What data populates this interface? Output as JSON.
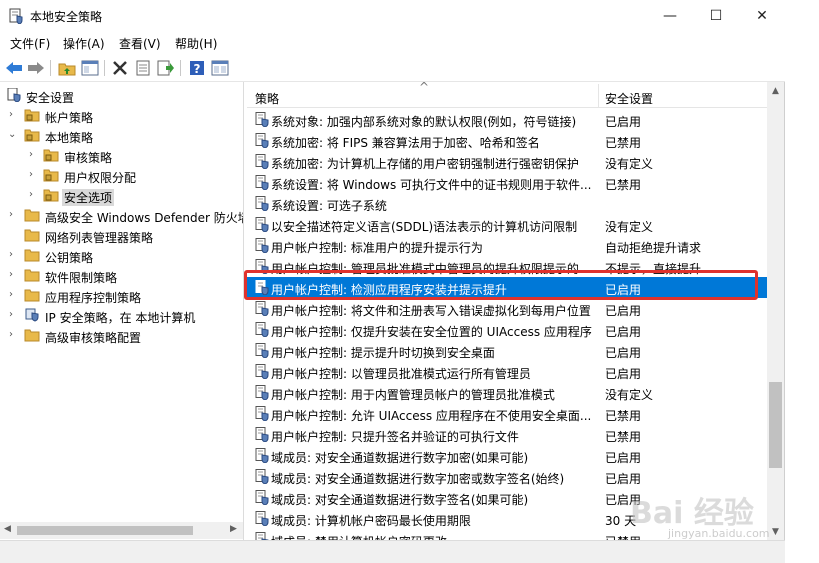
{
  "window": {
    "title": "本地安全策略",
    "minimize": "—",
    "maximize": "☐",
    "close": "✕"
  },
  "menu": [
    "文件(F)",
    "操作(A)",
    "查看(V)",
    "帮助(H)"
  ],
  "toolbar": {
    "icons": [
      "back-arrow-icon",
      "forward-arrow-icon",
      "up-folder-icon",
      "show-hide-tree-icon",
      "delete-icon",
      "properties-icon",
      "export-list-icon",
      "help-icon",
      "view-icon"
    ]
  },
  "tree": [
    {
      "label": "安全设置",
      "level": 0,
      "arrow": ""
    },
    {
      "label": "帐户策略",
      "level": 1,
      "arrow": "›"
    },
    {
      "label": "本地策略",
      "level": 1,
      "arrow": "⌄"
    },
    {
      "label": "审核策略",
      "level": 2,
      "arrow": "›"
    },
    {
      "label": "用户权限分配",
      "level": 2,
      "arrow": "›"
    },
    {
      "label": "安全选项",
      "level": 2,
      "arrow": "›",
      "selected": true
    },
    {
      "label": "高级安全 Windows Defender 防火墙",
      "level": 1,
      "arrow": "›"
    },
    {
      "label": "网络列表管理器策略",
      "level": 1,
      "arrow": ""
    },
    {
      "label": "公钥策略",
      "level": 1,
      "arrow": "›"
    },
    {
      "label": "软件限制策略",
      "level": 1,
      "arrow": "›"
    },
    {
      "label": "应用程序控制策略",
      "level": 1,
      "arrow": "›"
    },
    {
      "label": "IP 安全策略，在 本地计算机",
      "level": 1,
      "arrow": "›"
    },
    {
      "label": "高级审核策略配置",
      "level": 1,
      "arrow": "›"
    }
  ],
  "list": {
    "col_policy": "策略",
    "col_setting": "安全设置",
    "sort_indicator": "^",
    "rows": [
      {
        "name": "系统对象: 加强内部系统对象的默认权限(例如，符号链接)",
        "setting": "已启用"
      },
      {
        "name": "系统加密: 将 FIPS 兼容算法用于加密、哈希和签名",
        "setting": "已禁用"
      },
      {
        "name": "系统加密: 为计算机上存储的用户密钥强制进行强密钥保护",
        "setting": "没有定义"
      },
      {
        "name": "系统设置: 将 Windows 可执行文件中的证书规则用于软件...",
        "setting": "已禁用"
      },
      {
        "name": "系统设置: 可选子系统",
        "setting": ""
      },
      {
        "name": "以安全描述符定义语言(SDDL)语法表示的计算机访问限制",
        "setting": "没有定义"
      },
      {
        "name": "用户帐户控制: 标准用户的提升提示行为",
        "setting": "自动拒绝提升请求"
      },
      {
        "name": "用户帐户控制: 管理员批准模式中管理员的提升权限提示的...",
        "setting": "不提示，直接提升"
      },
      {
        "name": "用户帐户控制: 检测应用程序安装并提示提升",
        "setting": "已启用",
        "selected": true
      },
      {
        "name": "用户帐户控制: 将文件和注册表写入错误虚拟化到每用户位置",
        "setting": "已启用"
      },
      {
        "name": "用户帐户控制: 仅提升安装在安全位置的 UIAccess 应用程序",
        "setting": "已启用"
      },
      {
        "name": "用户帐户控制: 提示提升时切换到安全桌面",
        "setting": "已启用"
      },
      {
        "name": "用户帐户控制: 以管理员批准模式运行所有管理员",
        "setting": "已启用"
      },
      {
        "name": "用户帐户控制: 用于内置管理员帐户的管理员批准模式",
        "setting": "没有定义"
      },
      {
        "name": "用户帐户控制: 允许 UIAccess 应用程序在不使用安全桌面...",
        "setting": "已禁用"
      },
      {
        "name": "用户帐户控制: 只提升签名并验证的可执行文件",
        "setting": "已禁用"
      },
      {
        "name": "域成员: 对安全通道数据进行数字加密(如果可能)",
        "setting": "已启用"
      },
      {
        "name": "域成员: 对安全通道数据进行数字加密或数字签名(始终)",
        "setting": "已启用"
      },
      {
        "name": "域成员: 对安全通道数据进行数字签名(如果可能)",
        "setting": "已启用"
      },
      {
        "name": "域成员: 计算机帐户密码最长使用期限",
        "setting": "30 天"
      },
      {
        "name": "域成员: 禁用计算机帐户密码更改",
        "setting": "已禁用"
      }
    ]
  },
  "watermark": {
    "text": "Bai 经验",
    "url": "jingyan.baidu.com"
  },
  "colors": {
    "selection": "#0078d7",
    "highlight_box": "#e0322c",
    "folder": "#e8b94a"
  }
}
